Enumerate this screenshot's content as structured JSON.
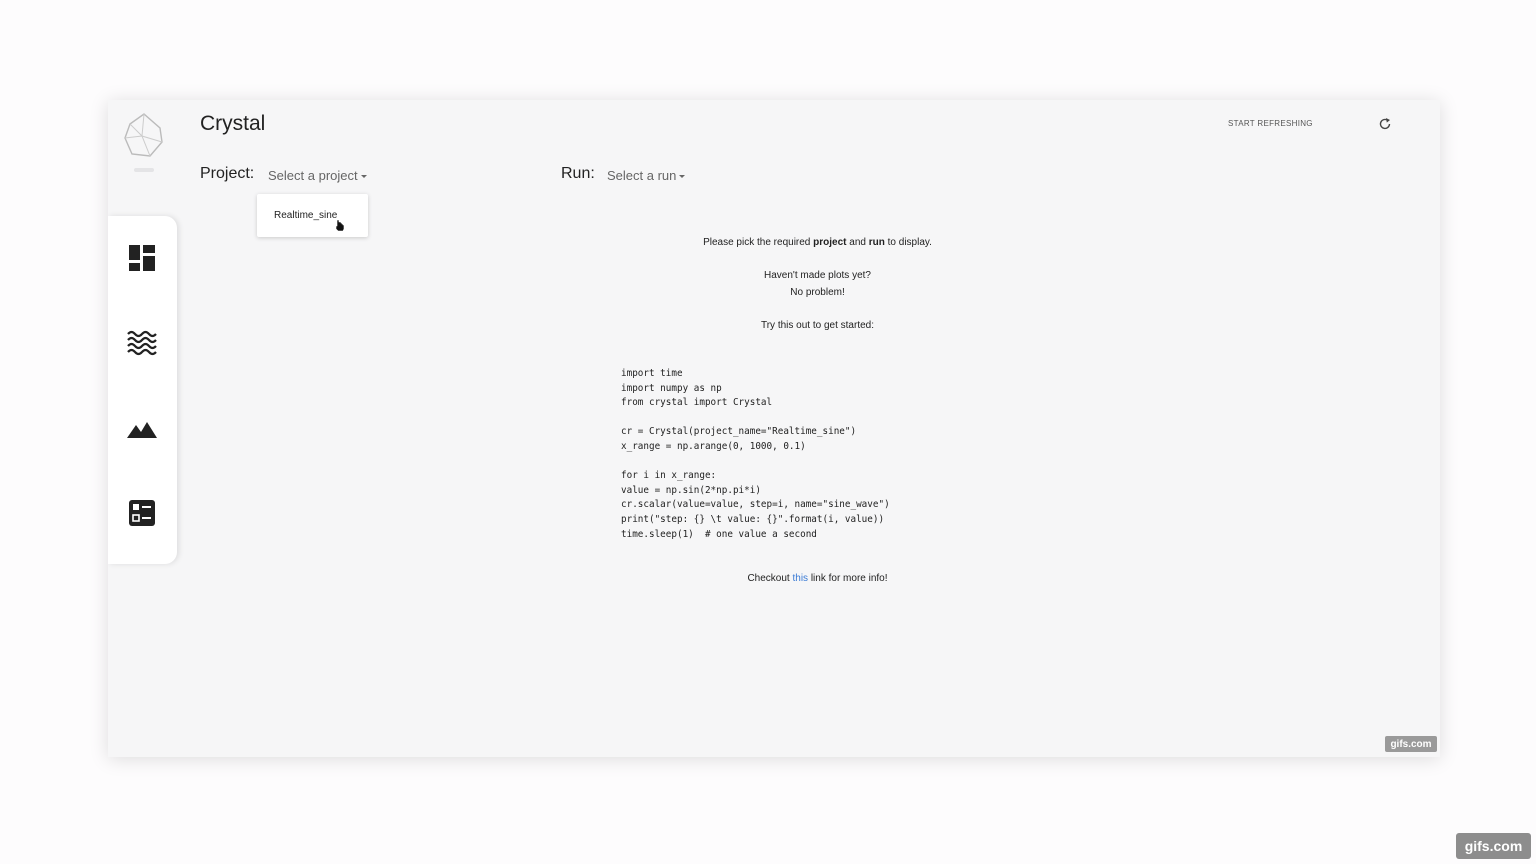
{
  "app": {
    "title": "Crystal",
    "refresh_label": "START REFRESHING"
  },
  "selectors": {
    "project_label": "Project:",
    "project_placeholder": "Select a project",
    "run_label": "Run:",
    "run_placeholder": "Select a run"
  },
  "dropdown": {
    "items": [
      "Realtime_sine"
    ]
  },
  "sidebar": {
    "icons": [
      "dashboard-icon",
      "waves-icon",
      "mountains-icon",
      "table-icon"
    ]
  },
  "main": {
    "pick_prefix": "Please pick the required ",
    "pick_project": "project",
    "pick_and": " and ",
    "pick_run": "run",
    "pick_suffix": " to display.",
    "no_plots_1": "Haven't made plots yet?",
    "no_plots_2": "No problem!",
    "try_this": "Try this out to get started:",
    "code_lines": [
      "import time",
      "import numpy as np",
      "from crystal import Crystal",
      "",
      "cr = Crystal(project_name=\"Realtime_sine\")",
      "x_range = np.arange(0, 1000, 0.1)",
      "",
      "for i in x_range:",
      "value = np.sin(2*np.pi*i)",
      "cr.scalar(value=value, step=i, name=\"sine_wave\")",
      "print(\"step: {} \\t value: {}\".format(i, value))",
      "time.sleep(1)  # one value a second"
    ],
    "footer_prefix": "Checkout ",
    "footer_link": "this",
    "footer_suffix": " link for more info!"
  },
  "watermarks": {
    "inner": "gifs.com",
    "outer": "gifs.com"
  }
}
